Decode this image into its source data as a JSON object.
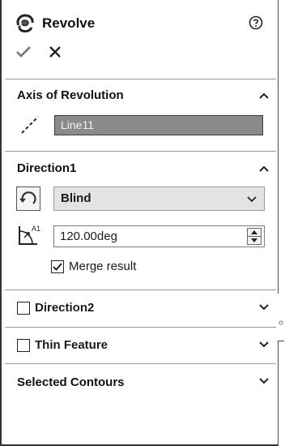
{
  "header": {
    "title": "Revolve",
    "icon": "revolve-icon",
    "help_icon": "help-icon"
  },
  "actions": {
    "ok_icon": "checkmark-icon",
    "cancel_icon": "close-icon"
  },
  "axis_section": {
    "title": "Axis of Revolution",
    "field_value": "Line11",
    "icon": "axis-line-icon",
    "collapsed": false
  },
  "direction1": {
    "title": "Direction1",
    "end_condition": "Blind",
    "angle_value": "120.00deg",
    "merge_label": "Merge result",
    "merge_checked": true,
    "collapsed": false
  },
  "direction2": {
    "title": "Direction2",
    "checked": false,
    "collapsed": true
  },
  "thin_feature": {
    "title": "Thin Feature",
    "checked": false,
    "collapsed": true
  },
  "selected_contours": {
    "title": "Selected Contours",
    "collapsed": true
  },
  "colors": {
    "field_bg": "#8a8a8a",
    "select_bg": "#e3e3e3",
    "divider": "#9a9a9a"
  }
}
